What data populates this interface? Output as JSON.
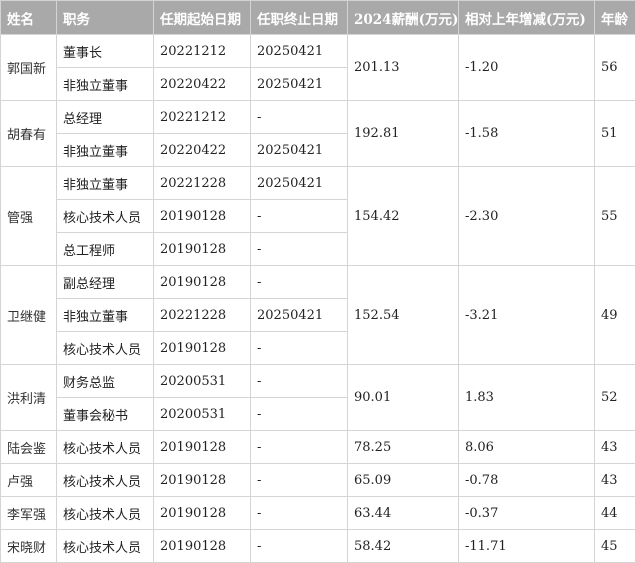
{
  "headers": {
    "name": "姓名",
    "position": "职务",
    "start": "任期起始日期",
    "end": "任职终止日期",
    "pay": "2024薪酬(万元)",
    "change": "相对上年增减(万元)",
    "age": "年龄"
  },
  "people": [
    {
      "name": "郭国新",
      "pay": "201.13",
      "change": "-1.20",
      "age": "56",
      "roles": [
        {
          "position": "董事长",
          "start": "20221212",
          "end": "20250421"
        },
        {
          "position": "非独立董事",
          "start": "20220422",
          "end": "20250421"
        }
      ]
    },
    {
      "name": "胡春有",
      "pay": "192.81",
      "change": "-1.58",
      "age": "51",
      "roles": [
        {
          "position": "总经理",
          "start": "20221212",
          "end": "-"
        },
        {
          "position": "非独立董事",
          "start": "20220422",
          "end": "20250421"
        }
      ]
    },
    {
      "name": "管强",
      "pay": "154.42",
      "change": "-2.30",
      "age": "55",
      "roles": [
        {
          "position": "非独立董事",
          "start": "20221228",
          "end": "20250421"
        },
        {
          "position": "核心技术人员",
          "start": "20190128",
          "end": "-"
        },
        {
          "position": "总工程师",
          "start": "20190128",
          "end": "-"
        }
      ]
    },
    {
      "name": "卫继健",
      "pay": "152.54",
      "change": "-3.21",
      "age": "49",
      "roles": [
        {
          "position": "副总经理",
          "start": "20190128",
          "end": "-"
        },
        {
          "position": "非独立董事",
          "start": "20221228",
          "end": "20250421"
        },
        {
          "position": "核心技术人员",
          "start": "20190128",
          "end": "-"
        }
      ]
    },
    {
      "name": "洪利清",
      "pay": "90.01",
      "change": "1.83",
      "age": "52",
      "roles": [
        {
          "position": "财务总监",
          "start": "20200531",
          "end": "-"
        },
        {
          "position": "董事会秘书",
          "start": "20200531",
          "end": "-"
        }
      ]
    },
    {
      "name": "陆会鉴",
      "pay": "78.25",
      "change": "8.06",
      "age": "43",
      "roles": [
        {
          "position": "核心技术人员",
          "start": "20190128",
          "end": "-"
        }
      ]
    },
    {
      "name": "卢强",
      "pay": "65.09",
      "change": "-0.78",
      "age": "43",
      "roles": [
        {
          "position": "核心技术人员",
          "start": "20190128",
          "end": "-"
        }
      ]
    },
    {
      "name": "李军强",
      "pay": "63.44",
      "change": "-0.37",
      "age": "44",
      "roles": [
        {
          "position": "核心技术人员",
          "start": "20190128",
          "end": "-"
        }
      ]
    },
    {
      "name": "宋晓财",
      "pay": "58.42",
      "change": "-11.71",
      "age": "45",
      "roles": [
        {
          "position": "核心技术人员",
          "start": "20190128",
          "end": "-"
        }
      ]
    }
  ]
}
